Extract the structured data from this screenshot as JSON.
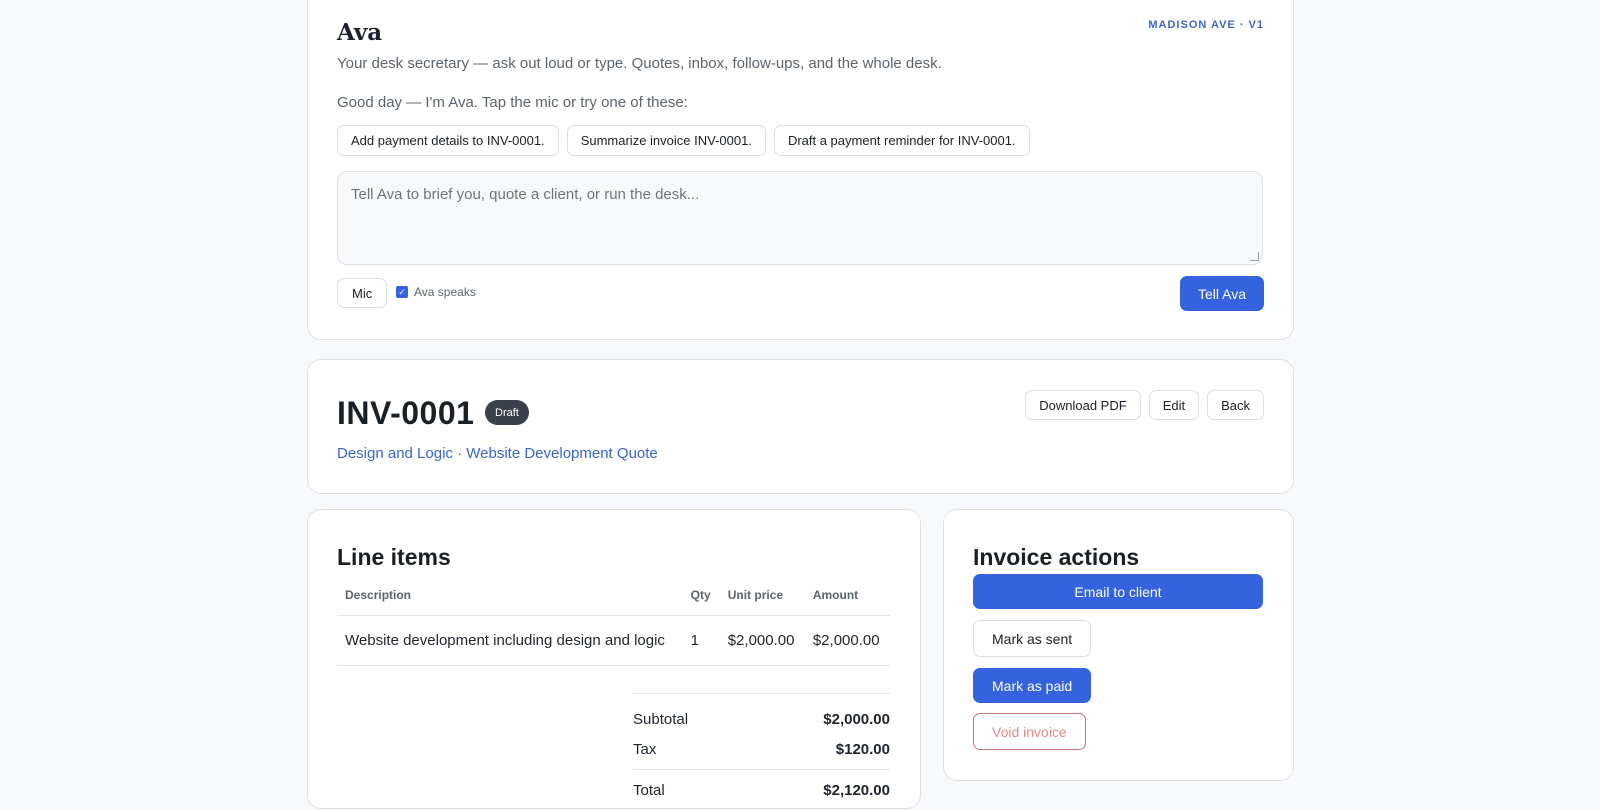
{
  "ava": {
    "title": "Ava",
    "tag": "MADISON AVE · V1",
    "subtitle": "Your desk secretary — ask out loud or type. Quotes, inbox, follow-ups, and the whole desk.",
    "greeting": "Good day — I'm Ava. Tap the mic or try one of these:",
    "suggestions": [
      "Add payment details to INV-0001.",
      "Summarize invoice INV-0001.",
      "Draft a payment reminder for INV-0001."
    ],
    "input_placeholder": "Tell Ava to brief you, quote a client, or run the desk...",
    "mic_label": "Mic",
    "speaks_label": "Ava speaks",
    "speaks_checked": true,
    "submit_label": "Tell Ava"
  },
  "invoice": {
    "number": "INV-0001",
    "status": "Draft",
    "client": "Design and Logic",
    "separator": "·",
    "quote": "Website Development Quote",
    "download_label": "Download PDF",
    "edit_label": "Edit",
    "back_label": "Back"
  },
  "line_items": {
    "title": "Line items",
    "columns": [
      "Description",
      "Qty",
      "Unit price",
      "Amount"
    ],
    "rows": [
      [
        "Website development including design and logic",
        "1",
        "$2,000.00",
        "$2,000.00"
      ]
    ],
    "subtotal_label": "Subtotal",
    "subtotal": "$2,000.00",
    "tax_label": "Tax",
    "tax": "$120.00",
    "total_label": "Total",
    "total": "$2,120.00"
  },
  "actions": {
    "title": "Invoice actions",
    "email": "Email to client",
    "mark_sent": "Mark as sent",
    "mark_paid": "Mark as paid",
    "void": "Void invoice"
  },
  "colors": {
    "accent": "#3563df",
    "link": "#3566c9",
    "badge": "#3a414b",
    "danger": "#c67474"
  }
}
